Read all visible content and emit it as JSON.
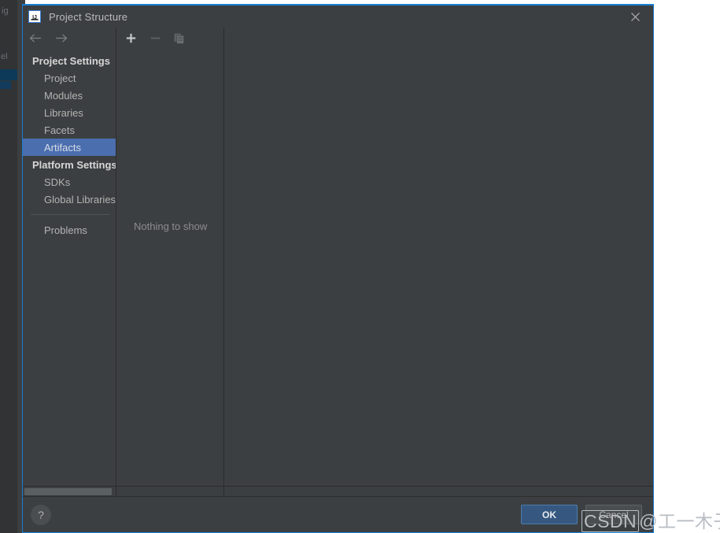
{
  "window": {
    "title": "Project Structure",
    "logo_icon": "intellij-idea-logo",
    "close_icon": "close-icon"
  },
  "nav_toolbar": {
    "back_icon": "arrow-left-icon",
    "back_label": "Back",
    "forward_icon": "arrow-right-icon",
    "forward_label": "Forward"
  },
  "sidebar": {
    "items": [
      {
        "label": "Project Settings",
        "type": "group",
        "selected": false
      },
      {
        "label": "Project",
        "type": "leaf",
        "selected": false
      },
      {
        "label": "Modules",
        "type": "leaf",
        "selected": false
      },
      {
        "label": "Libraries",
        "type": "leaf",
        "selected": false
      },
      {
        "label": "Facets",
        "type": "leaf",
        "selected": false
      },
      {
        "label": "Artifacts",
        "type": "leaf",
        "selected": true
      },
      {
        "label": "Platform Settings",
        "type": "group",
        "selected": false
      },
      {
        "label": "SDKs",
        "type": "leaf",
        "selected": false
      },
      {
        "label": "Global Libraries",
        "type": "leaf",
        "selected": false
      },
      {
        "label": "Problems",
        "type": "leaf",
        "selected": false
      }
    ]
  },
  "artifacts_toolbar": {
    "add_icon": "plus-icon",
    "add_label": "Add",
    "remove_icon": "minus-icon",
    "remove_label": "Remove",
    "copy_icon": "copy-icon",
    "copy_label": "Copy"
  },
  "artifacts_list": {
    "empty_text": "Nothing to show"
  },
  "footer": {
    "help_icon": "question-mark-icon",
    "help_label": "?",
    "ok_label": "OK",
    "cancel_label": "Cancel"
  },
  "watermark": {
    "tag": "CSDN",
    "handle": "@工一木子"
  },
  "background": {
    "ghost_1": "ig",
    "ghost_2": "el"
  },
  "colors": {
    "dialog_bg": "#3c3f41",
    "dialog_border": "#1a7fd4",
    "selection": "#4b6eaf",
    "ok_button": "#365880",
    "text_primary": "#bbbbbb",
    "text_muted": "#8c8c8c"
  }
}
